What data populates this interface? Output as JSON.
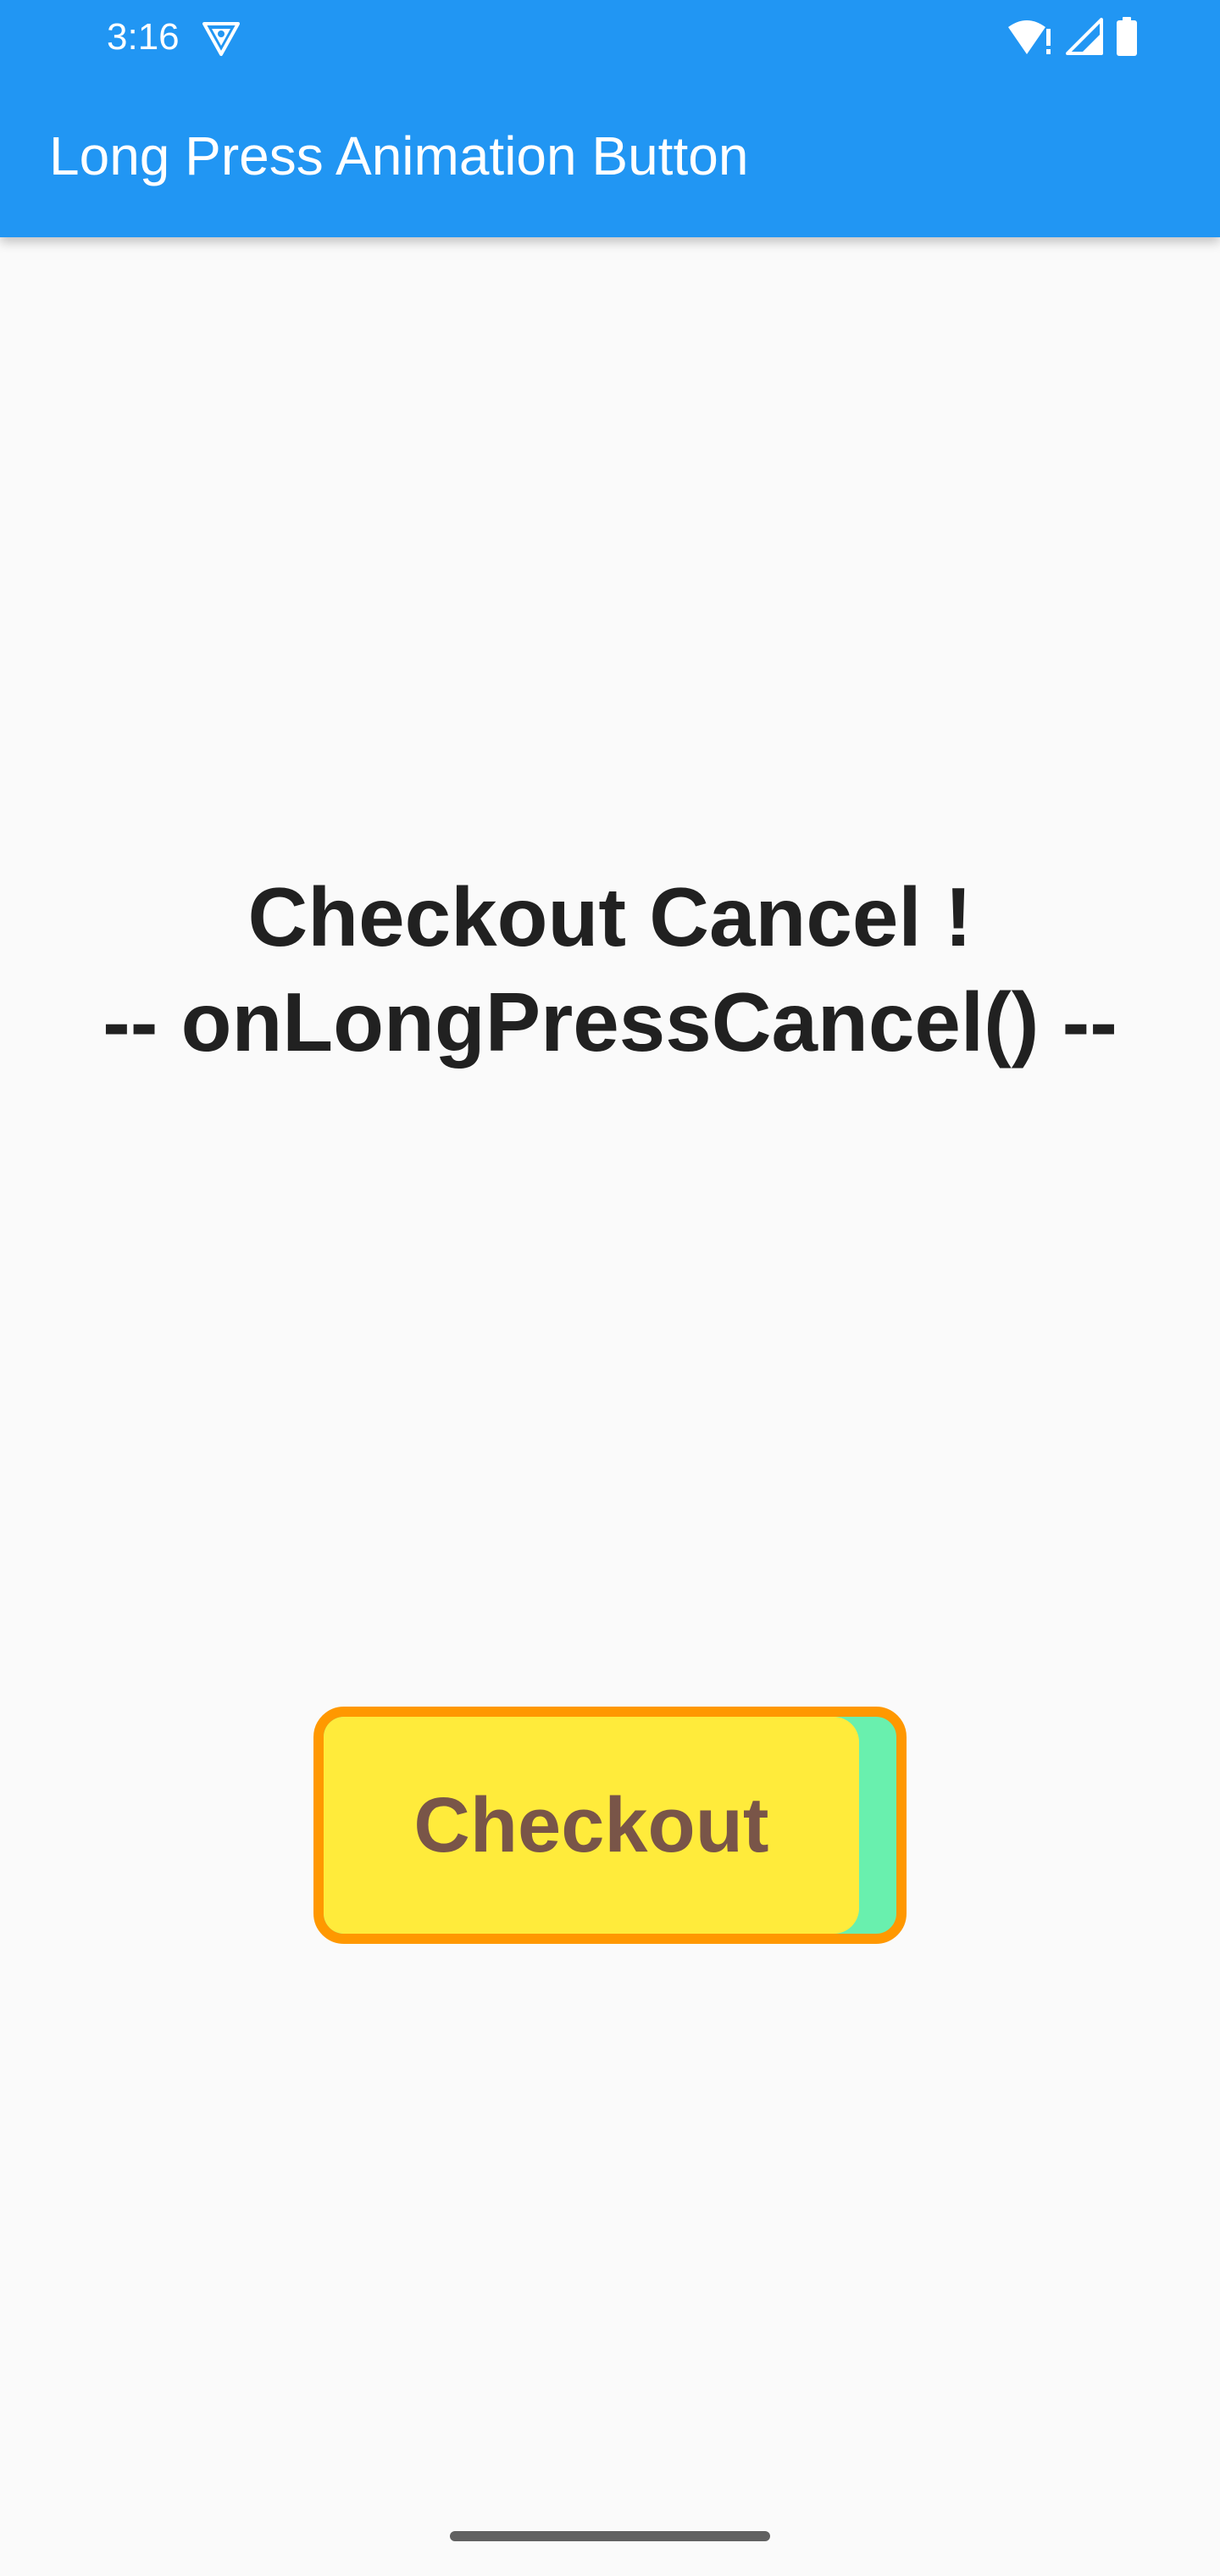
{
  "status_bar": {
    "time": "3:16",
    "app_icon": "shield-app-icon",
    "icons": [
      "wifi-alert-icon",
      "cellular-signal-icon",
      "battery-icon"
    ]
  },
  "app_bar": {
    "title": "Long Press Animation Button",
    "color": "#2196f3"
  },
  "message": {
    "line1": "Checkout Cancel !",
    "line2": "-- onLongPressCancel() --"
  },
  "checkout_button": {
    "label": "Checkout",
    "fill_color": "#ffeb3b",
    "progress_color": "#69f0ae",
    "border_color": "#ff9800",
    "text_color": "#795548"
  }
}
